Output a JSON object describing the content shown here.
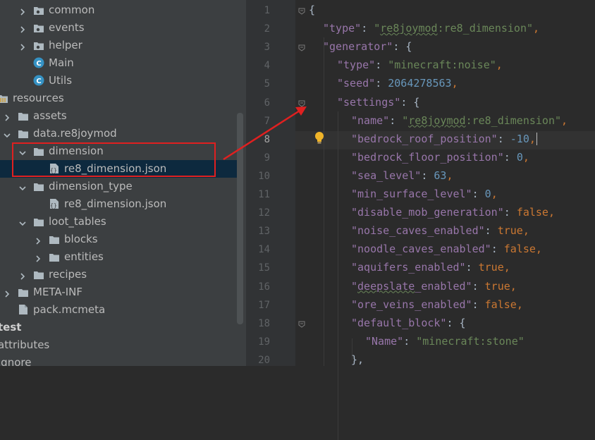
{
  "project_tree": {
    "rows": [
      {
        "label": "common",
        "icon": "package-folder-icon",
        "arrow": "collapsed"
      },
      {
        "label": "events",
        "icon": "package-folder-icon",
        "arrow": "collapsed"
      },
      {
        "label": "helper",
        "icon": "package-folder-icon",
        "arrow": "collapsed"
      },
      {
        "label": "Main",
        "icon": "java-class-icon",
        "arrow": "none"
      },
      {
        "label": "Utils",
        "icon": "java-class-icon",
        "arrow": "none"
      },
      {
        "label": "resources",
        "icon": "resources-folder-icon",
        "arrow": "none"
      },
      {
        "label": "assets",
        "icon": "folder-icon",
        "arrow": "collapsed"
      },
      {
        "label": "data.re8joymod",
        "icon": "folder-icon",
        "arrow": "expanded"
      },
      {
        "label": "dimension",
        "icon": "folder-icon",
        "arrow": "expanded"
      },
      {
        "label": "re8_dimension.json",
        "icon": "json-file-icon",
        "arrow": "none",
        "selected": true
      },
      {
        "label": "dimension_type",
        "icon": "folder-icon",
        "arrow": "expanded"
      },
      {
        "label": "re8_dimension.json",
        "icon": "json-file-icon",
        "arrow": "none"
      },
      {
        "label": "loot_tables",
        "icon": "folder-icon",
        "arrow": "expanded"
      },
      {
        "label": "blocks",
        "icon": "folder-icon",
        "arrow": "collapsed"
      },
      {
        "label": "entities",
        "icon": "folder-icon",
        "arrow": "collapsed"
      },
      {
        "label": "recipes",
        "icon": "folder-icon",
        "arrow": "collapsed"
      },
      {
        "label": "META-INF",
        "icon": "folder-icon",
        "arrow": "collapsed"
      },
      {
        "label": "pack.mcmeta",
        "icon": "file-icon",
        "arrow": "none"
      },
      {
        "label": "test",
        "icon": "none",
        "arrow": "none",
        "bold": true
      },
      {
        "label": "attributes",
        "icon": "none",
        "arrow": "none"
      },
      {
        "label": "ignore",
        "icon": "none",
        "arrow": "none"
      }
    ]
  },
  "editor": {
    "current_line": 8,
    "line_numbers": [
      "1",
      "2",
      "3",
      "4",
      "5",
      "6",
      "7",
      "8",
      "9",
      "10",
      "11",
      "12",
      "13",
      "14",
      "15",
      "16",
      "17",
      "18",
      "19",
      "20"
    ],
    "lines": [
      [
        {
          "t": "{",
          "c": "p"
        }
      ],
      [
        {
          "t": "\"type\"",
          "c": "k"
        },
        {
          "t": ": ",
          "c": "p"
        },
        {
          "t": "\"re8joymod:re8_dimension\"",
          "c": "s"
        },
        {
          "t": ",",
          "c": "b"
        }
      ],
      [
        {
          "t": "\"generator\"",
          "c": "k"
        },
        {
          "t": ": {",
          "c": "p"
        }
      ],
      [
        {
          "t": "\"type\"",
          "c": "k"
        },
        {
          "t": ": ",
          "c": "p"
        },
        {
          "t": "\"minecraft:noise\"",
          "c": "s"
        },
        {
          "t": ",",
          "c": "b"
        }
      ],
      [
        {
          "t": "\"seed\"",
          "c": "k"
        },
        {
          "t": ": ",
          "c": "p"
        },
        {
          "t": "2064278563",
          "c": "n"
        },
        {
          "t": ",",
          "c": "b"
        }
      ],
      [
        {
          "t": "\"settings\"",
          "c": "k"
        },
        {
          "t": ": {",
          "c": "p"
        }
      ],
      [
        {
          "t": "\"name\"",
          "c": "k"
        },
        {
          "t": ": ",
          "c": "p"
        },
        {
          "t": "\"re8joymod:re8_dimension\"",
          "c": "s"
        },
        {
          "t": ",",
          "c": "b"
        }
      ],
      [
        {
          "t": "\"bedrock_roof_position\"",
          "c": "k"
        },
        {
          "t": ": ",
          "c": "p"
        },
        {
          "t": "-10",
          "c": "n"
        },
        {
          "t": ",",
          "c": "b"
        }
      ],
      [
        {
          "t": "\"bedrock_floor_position\"",
          "c": "k"
        },
        {
          "t": ": ",
          "c": "p"
        },
        {
          "t": "0",
          "c": "n"
        },
        {
          "t": ",",
          "c": "b"
        }
      ],
      [
        {
          "t": "\"sea_level\"",
          "c": "k"
        },
        {
          "t": ": ",
          "c": "p"
        },
        {
          "t": "63",
          "c": "n"
        },
        {
          "t": ",",
          "c": "b"
        }
      ],
      [
        {
          "t": "\"min_surface_level\"",
          "c": "k"
        },
        {
          "t": ": ",
          "c": "p"
        },
        {
          "t": "0",
          "c": "n"
        },
        {
          "t": ",",
          "c": "b"
        }
      ],
      [
        {
          "t": "\"disable_mob_generation\"",
          "c": "k"
        },
        {
          "t": ": ",
          "c": "p"
        },
        {
          "t": "false",
          "c": "b"
        },
        {
          "t": ",",
          "c": "b"
        }
      ],
      [
        {
          "t": "\"noise_caves_enabled\"",
          "c": "k"
        },
        {
          "t": ": ",
          "c": "p"
        },
        {
          "t": "true",
          "c": "b"
        },
        {
          "t": ",",
          "c": "b"
        }
      ],
      [
        {
          "t": "\"noodle_caves_enabled\"",
          "c": "k"
        },
        {
          "t": ": ",
          "c": "p"
        },
        {
          "t": "false",
          "c": "b"
        },
        {
          "t": ",",
          "c": "b"
        }
      ],
      [
        {
          "t": "\"aquifers_enabled\"",
          "c": "k"
        },
        {
          "t": ": ",
          "c": "p"
        },
        {
          "t": "true",
          "c": "b"
        },
        {
          "t": ",",
          "c": "b"
        }
      ],
      [
        {
          "t": "\"deepslate_enabled\"",
          "c": "k"
        },
        {
          "t": ": ",
          "c": "p"
        },
        {
          "t": "true",
          "c": "b"
        },
        {
          "t": ",",
          "c": "b"
        }
      ],
      [
        {
          "t": "\"ore_veins_enabled\"",
          "c": "k"
        },
        {
          "t": ": ",
          "c": "p"
        },
        {
          "t": "false",
          "c": "b"
        },
        {
          "t": ",",
          "c": "b"
        }
      ],
      [
        {
          "t": "\"default_block\"",
          "c": "k"
        },
        {
          "t": ": {",
          "c": "p"
        }
      ],
      [
        {
          "t": "\"Name\"",
          "c": "k"
        },
        {
          "t": ": ",
          "c": "p"
        },
        {
          "t": "\"minecraft:stone\"",
          "c": "s"
        }
      ],
      [
        {
          "t": "},",
          "c": "p"
        }
      ]
    ]
  },
  "colors": {
    "annotation_red": "#e02020",
    "selection": "#0d293e",
    "bulb": "#f0b429"
  }
}
